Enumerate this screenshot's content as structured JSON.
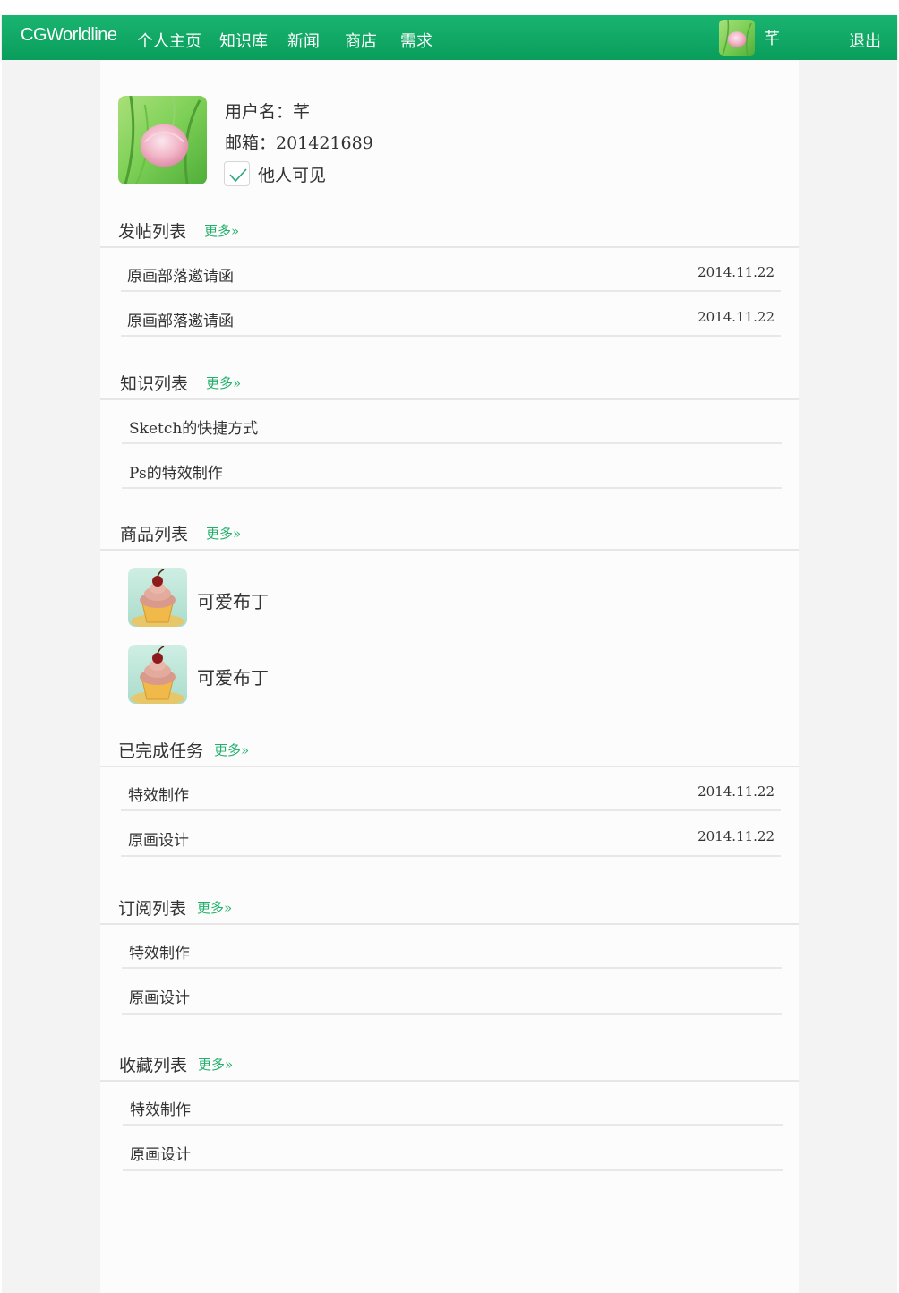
{
  "nav": {
    "brand": "CGWorldline",
    "items": [
      "个人主页",
      "知识库",
      "新闻",
      "商店",
      "需求"
    ],
    "user": "芊",
    "logout": "退出"
  },
  "profile": {
    "username": "用户名：芊",
    "email": "邮箱：201421689",
    "visible_label": "他人可见",
    "visible_checked": true
  },
  "more_label": "更多»",
  "sections": {
    "posts": {
      "title": "发帖列表",
      "items": [
        {
          "text": "原画部落邀请函",
          "date": "2014.11.22"
        },
        {
          "text": "原画部落邀请函",
          "date": "2014.11.22"
        }
      ]
    },
    "knowledge": {
      "title": "知识列表",
      "items": [
        {
          "text": "Sketch的快捷方式"
        },
        {
          "text": "Ps的特效制作"
        }
      ]
    },
    "products": {
      "title": "商品列表",
      "items": [
        {
          "text": "可爱布丁"
        },
        {
          "text": "可爱布丁"
        }
      ]
    },
    "tasks": {
      "title": "已完成任务",
      "items": [
        {
          "text": "特效制作",
          "date": "2014.11.22"
        },
        {
          "text": "原画设计",
          "date": "2014.11.22"
        }
      ]
    },
    "subscriptions": {
      "title": "订阅列表",
      "items": [
        {
          "text": "特效制作"
        },
        {
          "text": "原画设计"
        }
      ]
    },
    "favorites": {
      "title": "收藏列表",
      "items": [
        {
          "text": "特效制作"
        },
        {
          "text": "原画设计"
        }
      ]
    }
  },
  "colors": {
    "accent": "#22b06a",
    "nav_bg": "#0fa862",
    "side_bg": "#f3f3f3"
  }
}
